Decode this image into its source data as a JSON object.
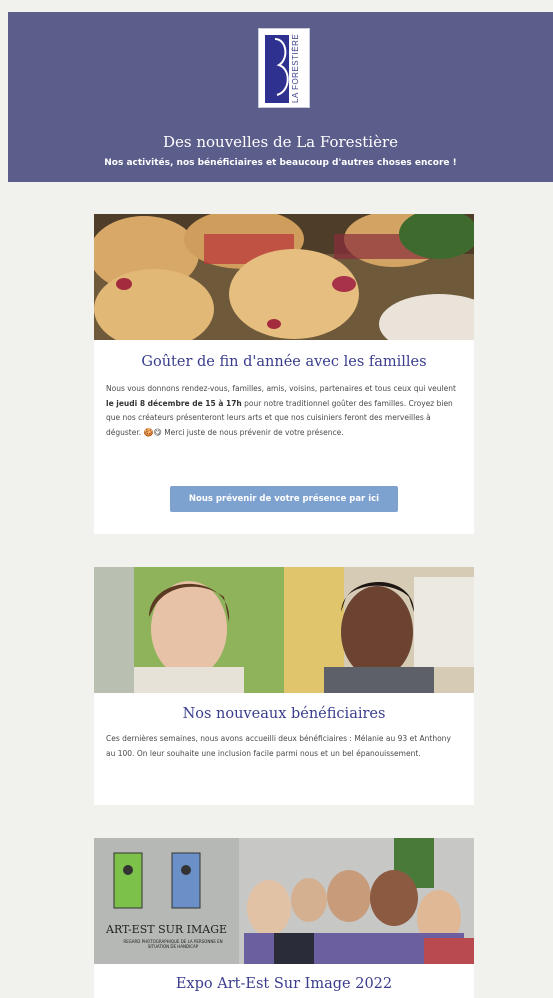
{
  "header": {
    "logo_text": "LA FORESTIÈRE",
    "title": "Des nouvelles de La Forestière",
    "subtitle": "Nos activités, nos bénéficiaires et beaucoup d'autres choses encore !"
  },
  "articles": [
    {
      "title": "Goûter de fin d'année avec les familles",
      "text_before": "Nous vous donnons rendez-vous, familles, amis, voisins, partenaires et tous ceux qui veulent ",
      "text_bold": "le jeudi 8 décembre de 15 à 17h",
      "text_after": " pour notre traditionnel goûter des familles. Croyez bien que nos créateurs présenteront leurs arts et que nos cuisiniers feront des merveilles à déguster. ",
      "emojis": "🍪😋",
      "text_end": " Merci juste de nous prévenir de votre présence.",
      "button_label": "Nous prévenir de votre présence par ici",
      "image_icon": "muffins-photo"
    },
    {
      "title": "Nos nouveaux bénéficiaires",
      "text": "Ces dernières semaines, nous avons accueilli deux bénéficiaires : Mélanie au 93 et Anthony au 100. On leur souhaite une inclusion facile parmi nous et un bel épanouissement.",
      "image_icon": "portraits-photo"
    },
    {
      "title": "Expo Art-Est Sur Image 2022",
      "poster_title": "ART-EST SUR IMAGE",
      "poster_subtitle": "REGARD PHOTOGRAPHIQUE DE LA PERSONNE EN SITUATION DE HANDICAP",
      "image_icon": "exhibition-group-photo"
    }
  ]
}
